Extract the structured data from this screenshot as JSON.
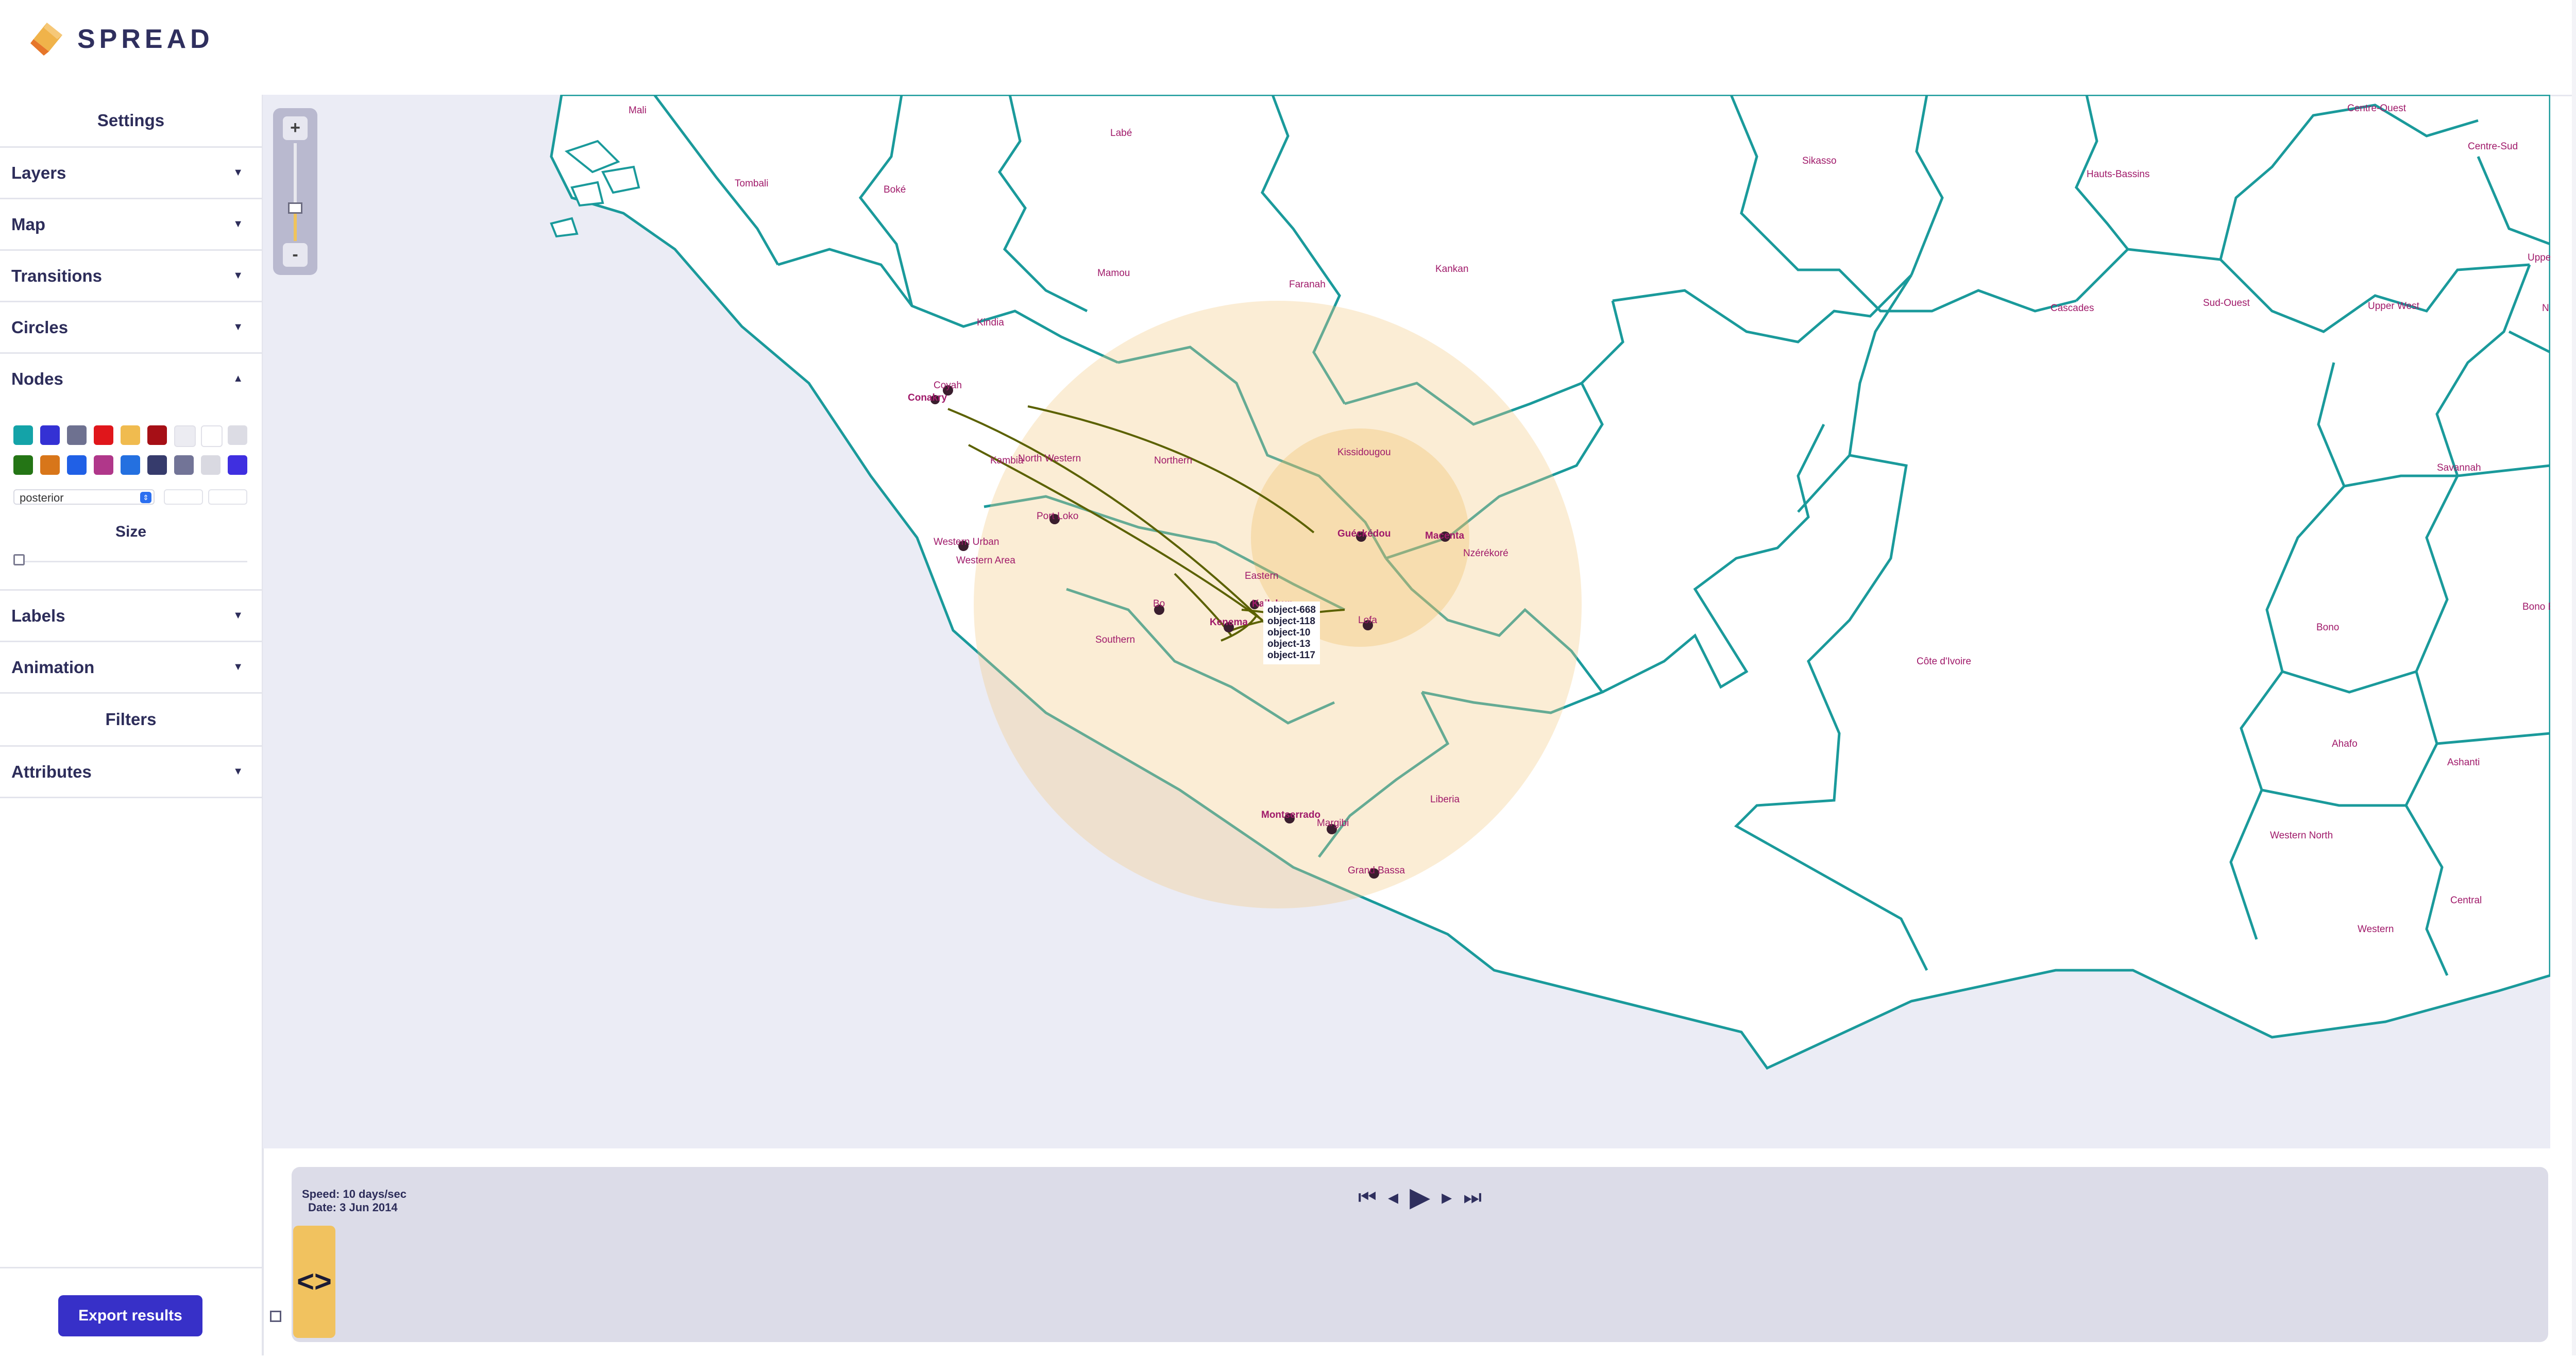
{
  "app": {
    "brand": "SPREAD"
  },
  "sidebar": {
    "settings_title": "Settings",
    "items": [
      {
        "label": "Layers",
        "caret": "▼"
      },
      {
        "label": "Map",
        "caret": "▼"
      },
      {
        "label": "Transitions",
        "caret": "▼"
      },
      {
        "label": "Circles",
        "caret": "▼"
      },
      {
        "label": "Nodes",
        "caret": "▲"
      }
    ],
    "nodes": {
      "swatches_row1": [
        "#14a3a8",
        "#3431d4",
        "#6e7190",
        "#e0161b",
        "#f0bb4f",
        "#a60f16",
        "#ececf2",
        "#ffffff",
        "#dcdce4"
      ],
      "swatches_row2": [
        "#247515",
        "#d8761a",
        "#2060e6",
        "#b0378a",
        "#2470e0",
        "#363b6c",
        "#727497",
        "#d9d9e1",
        "#3f2fe0"
      ],
      "attribute_select": "posterior",
      "select_arrow": "⇕",
      "size_label": "Size"
    },
    "items_after": [
      {
        "label": "Labels",
        "caret": "▼"
      },
      {
        "label": "Animation",
        "caret": "▼"
      }
    ],
    "filters_title": "Filters",
    "filter_items": [
      {
        "label": "Attributes",
        "caret": "▼"
      }
    ],
    "export_label": "Export results"
  },
  "map": {
    "zoom_in": "+",
    "zoom_out": "-",
    "colors": {
      "water": "#ebecf5",
      "land": "#ffffff",
      "border": "#1a9a9b",
      "label": "#a01a6a",
      "circle": "#f6d39a",
      "path": "#5b6100",
      "node": "#3a1e2e"
    },
    "region_labels": [
      {
        "text": "Mali"
      },
      {
        "text": "Labé"
      },
      {
        "text": "Boké"
      },
      {
        "text": "Tombali"
      },
      {
        "text": "Mamou"
      },
      {
        "text": "Kindia"
      },
      {
        "text": "Faranah"
      },
      {
        "text": "Kankan"
      },
      {
        "text": "Sikasso"
      },
      {
        "text": "Hauts-Bassins"
      },
      {
        "text": "Centre-Ouest"
      },
      {
        "text": "Centre-Sud"
      },
      {
        "text": "Upper"
      },
      {
        "text": "Cascades"
      },
      {
        "text": "Sud-Ouest"
      },
      {
        "text": "Upper West"
      },
      {
        "text": "N"
      },
      {
        "text": "Savannah"
      },
      {
        "text": "Kissidougou"
      },
      {
        "text": "Guéckédou"
      },
      {
        "text": "Macenta"
      },
      {
        "text": "Nzérékoré"
      },
      {
        "text": "Conakry"
      },
      {
        "text": "Coyah"
      },
      {
        "text": "Kambia"
      },
      {
        "text": "North Western"
      },
      {
        "text": "Northern"
      },
      {
        "text": "Port Loko"
      },
      {
        "text": "Western Urban"
      },
      {
        "text": "Western Area"
      },
      {
        "text": "Eastern"
      },
      {
        "text": "Southern"
      },
      {
        "text": "Bo"
      },
      {
        "text": "Kenema"
      },
      {
        "text": "Kailahun"
      },
      {
        "text": "Lofa"
      },
      {
        "text": "Liberia"
      },
      {
        "text": "Montserrado"
      },
      {
        "text": "Margibi"
      },
      {
        "text": "Grand Bassa"
      },
      {
        "text": "Côte d'Ivoire"
      },
      {
        "text": "Bono"
      },
      {
        "text": "Bono East"
      },
      {
        "text": "Ahafo"
      },
      {
        "text": "Ashanti"
      },
      {
        "text": "Western North"
      },
      {
        "text": "Central"
      },
      {
        "text": "Western"
      }
    ],
    "tooltip": [
      "object-668",
      "object-118",
      "object-10",
      "object-13",
      "object-117"
    ]
  },
  "timeline": {
    "speed": "Speed: 10 days/sec",
    "date": "Date: 3 Jun 2014",
    "controls": {
      "first": "⏮",
      "prev": "◂",
      "play": "▶",
      "next": "▸",
      "last": "⏭"
    },
    "handle_icon": "<>"
  }
}
